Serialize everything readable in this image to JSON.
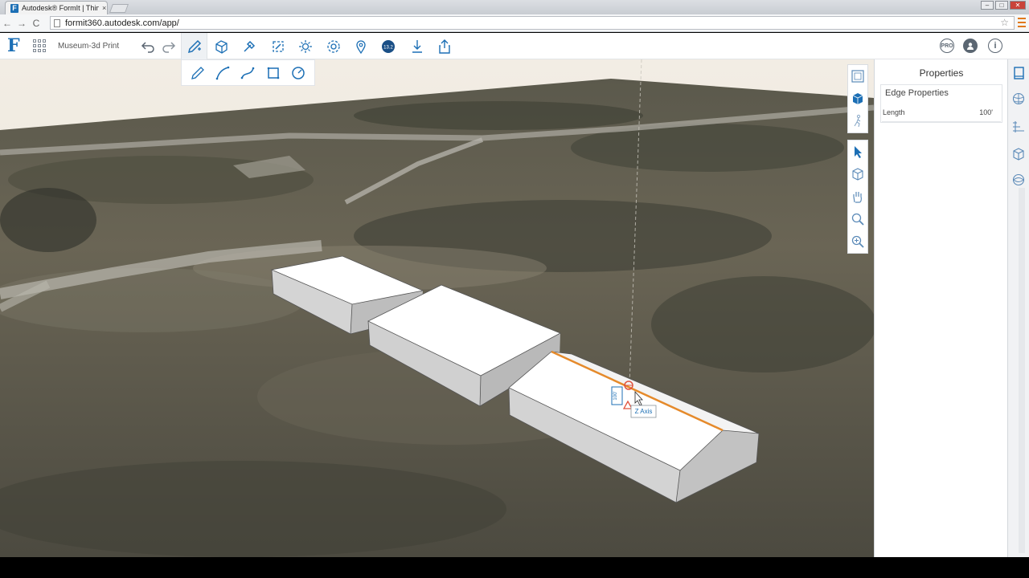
{
  "browser": {
    "tab_title": "Autodesk® FormIt | Think",
    "tab_close": "×",
    "url": "formit360.autodesk.com/app/",
    "back_glyph": "←",
    "forward_glyph": "→",
    "reload_glyph": "C",
    "star_glyph": "☆"
  },
  "app": {
    "logo_glyph": "F",
    "project_name": "Museum-3d Print",
    "toolbar_icons": [
      "undo-icon",
      "redo-icon",
      "sketch-pencil-icon",
      "shapes-icon",
      "tools-icon",
      "materials-icon",
      "sun-icon",
      "settings-icon",
      "location-icon",
      "level-icon",
      "import-icon",
      "share-icon"
    ],
    "level_badge": "13.2",
    "pro_badge": "PRO",
    "info_glyph": "i"
  },
  "sketch_tools": [
    "line-icon",
    "arc-icon",
    "spline-icon",
    "rectangle-icon",
    "circle-icon"
  ],
  "properties": {
    "title": "Properties",
    "section_title": "Edge Properties",
    "rows": [
      {
        "label": "Length",
        "value": "100'"
      }
    ]
  },
  "viewport": {
    "tooltip_axis": "Z Axis",
    "dimension_label": "100'"
  },
  "colors": {
    "accent": "#1c6fb5",
    "selected_edge": "#e58a2b",
    "snap_marker": "#e0533e"
  }
}
